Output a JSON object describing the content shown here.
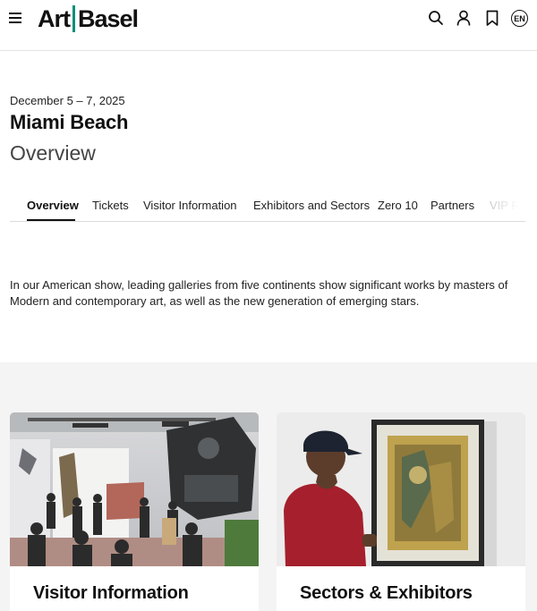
{
  "header": {
    "logo_left": "Art",
    "logo_right": "Basel",
    "logo_accent_color": "#0c8f7a",
    "icons": [
      "menu-icon",
      "search-icon",
      "user-icon",
      "bookmark-icon"
    ],
    "language": "EN"
  },
  "event": {
    "date": "December 5 – 7, 2025",
    "city": "Miami Beach",
    "page": "Overview"
  },
  "tabs": [
    {
      "label": "Overview",
      "active": true
    },
    {
      "label": "Tickets",
      "active": false
    },
    {
      "label": "Visitor Information",
      "active": false
    },
    {
      "label": "Exhibitors and Sectors",
      "active": false
    },
    {
      "label": "Zero 10",
      "active": false
    },
    {
      "label": "Partners",
      "active": false
    },
    {
      "label": "VIP Re",
      "active": false
    }
  ],
  "intro": "In our American show, leading galleries from five continents show significant works by masters of Modern and contemporary art, as well as the new generation of emerging stars.",
  "cards": [
    {
      "title": "Visitor Information"
    },
    {
      "title": "Sectors & Exhibitors"
    }
  ]
}
